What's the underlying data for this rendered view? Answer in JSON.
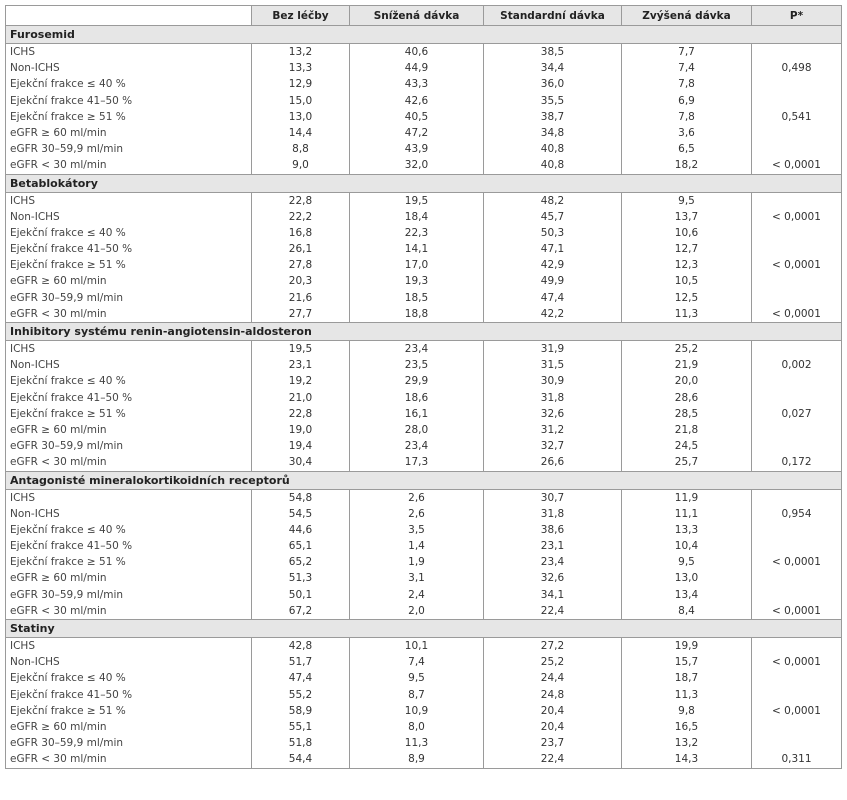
{
  "header": {
    "col_bez": "Bez léčby",
    "col_snizena": "Snížená dávka",
    "col_standard": "Standardní dávka",
    "col_zvysena": "Zvýšená dávka",
    "col_p": "P*"
  },
  "row_labels": [
    "ICHS",
    "Non-ICHS",
    "Ejekční frakce ≤ 40 %",
    "Ejekční frakce 41–50 %",
    "Ejekční frakce ≥ 51 %",
    "eGFR ≥ 60 ml/min",
    "eGFR 30–59,9 ml/min",
    "eGFR < 30 ml/min"
  ],
  "sections": [
    {
      "title": "Furosemid",
      "bez": [
        "13,2",
        "13,3",
        "12,9",
        "15,0",
        "13,0",
        "14,4",
        "8,8",
        "9,0"
      ],
      "snizena": [
        "40,6",
        "44,9",
        "43,3",
        "42,6",
        "40,5",
        "47,2",
        "43,9",
        "32,0"
      ],
      "standard": [
        "38,5",
        "34,4",
        "36,0",
        "35,5",
        "38,7",
        "34,8",
        "40,8",
        "40,8"
      ],
      "zvysena": [
        "7,7",
        "7,4",
        "7,8",
        "6,9",
        "7,8",
        "3,6",
        "6,5",
        "18,2"
      ],
      "p": [
        "",
        "0,498",
        "",
        "",
        "0,541",
        "",
        "",
        "< 0,0001"
      ]
    },
    {
      "title": "Betablokátory",
      "bez": [
        "22,8",
        "22,2",
        "16,8",
        "26,1",
        "27,8",
        "20,3",
        "21,6",
        "27,7"
      ],
      "snizena": [
        "19,5",
        "18,4",
        "22,3",
        "14,1",
        "17,0",
        "19,3",
        "18,5",
        "18,8"
      ],
      "standard": [
        "48,2",
        "45,7",
        "50,3",
        "47,1",
        "42,9",
        "49,9",
        "47,4",
        "42,2"
      ],
      "zvysena": [
        "9,5",
        "13,7",
        "10,6",
        "12,7",
        "12,3",
        "10,5",
        "12,5",
        "11,3"
      ],
      "p": [
        "",
        "< 0,0001",
        "",
        "",
        "< 0,0001",
        "",
        "",
        "< 0,0001"
      ]
    },
    {
      "title": "Inhibitory systému renin-angiotensin-aldosteron",
      "bez": [
        "19,5",
        "23,1",
        "19,2",
        "21,0",
        "22,8",
        "19,0",
        "19,4",
        "30,4"
      ],
      "snizena": [
        "23,4",
        "23,5",
        "29,9",
        "18,6",
        "16,1",
        "28,0",
        "23,4",
        "17,3"
      ],
      "standard": [
        "31,9",
        "31,5",
        "30,9",
        "31,8",
        "32,6",
        "31,2",
        "32,7",
        "26,6"
      ],
      "zvysena": [
        "25,2",
        "21,9",
        "20,0",
        "28,6",
        "28,5",
        "21,8",
        "24,5",
        "25,7"
      ],
      "p": [
        "",
        "0,002",
        "",
        "",
        "0,027",
        "",
        "",
        "0,172"
      ]
    },
    {
      "title": "Antagonisté mineralokortikoidních receptorů",
      "bez": [
        "54,8",
        "54,5",
        "44,6",
        "65,1",
        "65,2",
        "51,3",
        "50,1",
        "67,2"
      ],
      "snizena": [
        "2,6",
        "2,6",
        "3,5",
        "1,4",
        "1,9",
        "3,1",
        "2,4",
        "2,0"
      ],
      "standard": [
        "30,7",
        "31,8",
        "38,6",
        "23,1",
        "23,4",
        "32,6",
        "34,1",
        "22,4"
      ],
      "zvysena": [
        "11,9",
        "11,1",
        "13,3",
        "10,4",
        "9,5",
        "13,0",
        "13,4",
        "8,4"
      ],
      "p": [
        "",
        "0,954",
        "",
        "",
        "< 0,0001",
        "",
        "",
        "< 0,0001"
      ]
    },
    {
      "title": "Statiny",
      "bez": [
        "42,8",
        "51,7",
        "47,4",
        "55,2",
        "58,9",
        "55,1",
        "51,8",
        "54,4"
      ],
      "snizena": [
        "10,1",
        "7,4",
        "9,5",
        "8,7",
        "10,9",
        "8,0",
        "11,3",
        "8,9"
      ],
      "standard": [
        "27,2",
        "25,2",
        "24,4",
        "24,8",
        "20,4",
        "20,4",
        "23,7",
        "22,4"
      ],
      "zvysena": [
        "19,9",
        "15,7",
        "18,7",
        "11,3",
        "9,8",
        "16,5",
        "13,2",
        "14,3"
      ],
      "p": [
        "",
        "< 0,0001",
        "",
        "",
        "< 0,0001",
        "",
        "",
        "0,311"
      ]
    }
  ]
}
